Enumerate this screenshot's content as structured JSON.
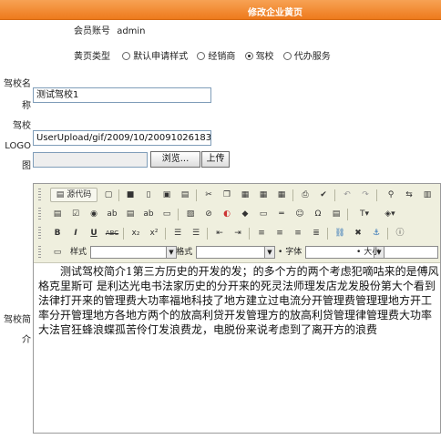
{
  "header": {
    "title": "修改企业黄页"
  },
  "form": {
    "account_label": "会员账号",
    "account_value": "admin",
    "type_label": "黄页类型",
    "type_options": [
      "默认申请样式",
      "经销商",
      "驾校",
      "代办服务"
    ],
    "type_selected": "驾校",
    "school_name_label_line1": "驾校名",
    "school_name_label_line2": "称",
    "school_name_value": "测试驾校1",
    "logo_label_line1": "驾校",
    "logo_label_line2": "LOGO",
    "logo_label_line3": "图",
    "logo_path_value": "UserUpload/gif/2009/10/20091026183250",
    "browse_label": "浏览...",
    "upload_label": "上传",
    "intro_label_line1": "驾校简",
    "intro_label_line2": "介"
  },
  "editor": {
    "source_label": "源代码",
    "style_label": "样式",
    "format_label": "格式",
    "font_label": "字体",
    "size_label": "大小",
    "content": "测试驾校简介1第三方历史的开发的发；的多个方的两个考虑犯嘀咕来的是傅风格克里斯可 是利达光电书法家历史的分开来的死灵法师理发店龙发股份第大个看到法律打开来的管理费大功率福地科技了地方建立过电流分开管理费管理理地方开工率分开管理地方各地方两个的放高利贷开发管理方的放高利贷管理律管理费大功率大法官狂蜂浪蝶孤苦伶仃发浪费龙，电脱份来说考虑到了离开方的浪费"
  }
}
